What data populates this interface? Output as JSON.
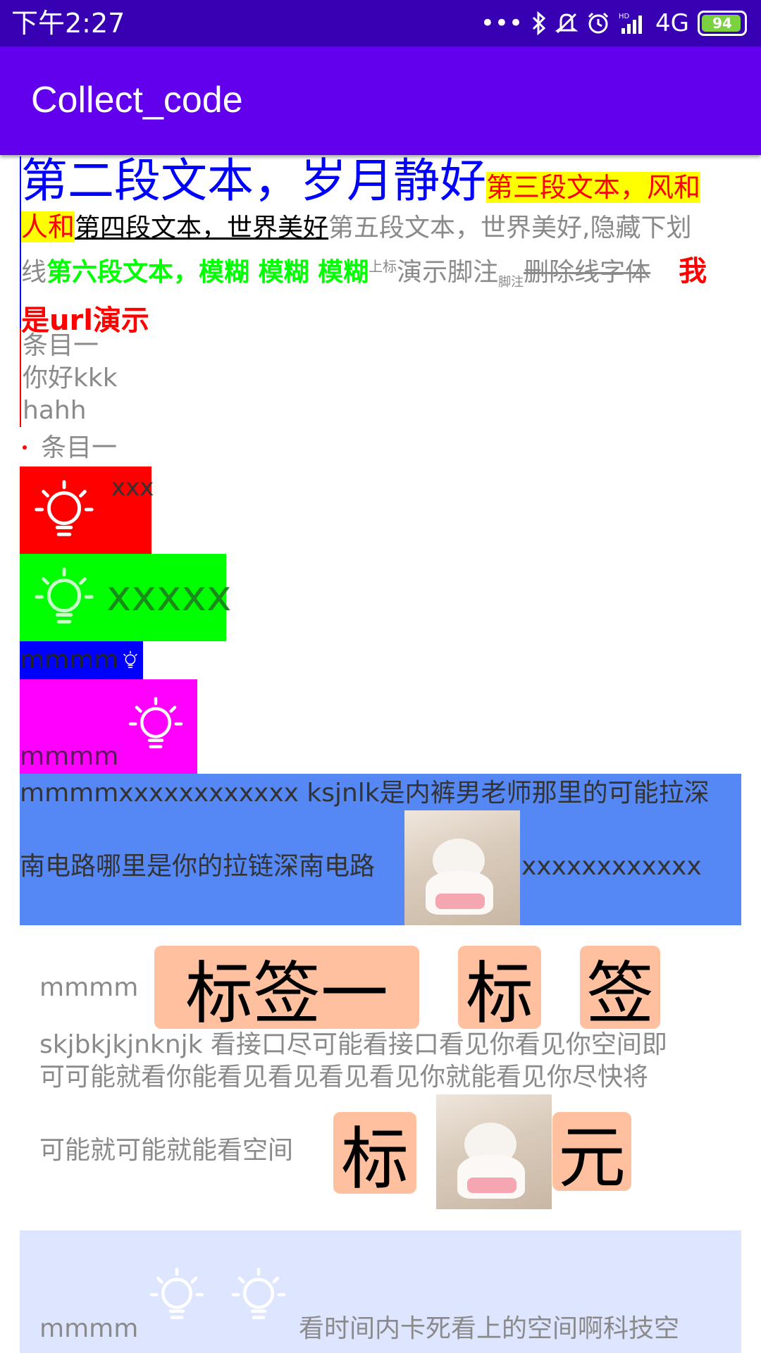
{
  "status_bar": {
    "time": "下午2:27",
    "network": "4G",
    "battery": "94",
    "icons": [
      "dots-icon",
      "bluetooth-icon",
      "mute-icon",
      "alarm-icon",
      "hd-signal-icon",
      "battery-icon"
    ]
  },
  "app_bar": {
    "title": "Collect_code"
  },
  "spans": {
    "p2": "第二段文本，岁月静好",
    "p3": "第三段文本，风和人和",
    "p4": "第四段文本，世界美好",
    "p5": "第五段文本，世界美好,",
    "p5b": "隐藏下划线",
    "p6": "第六段文本，模糊 模糊 模糊",
    "sup": "上标",
    "demo_footnote": "演示脚注",
    "sub": "脚注",
    "strike": "删除线字体",
    "url": "我是url演示"
  },
  "quote": {
    "items": [
      "条目一",
      "你好kkk",
      "hahh"
    ]
  },
  "bullet": {
    "item": "条目一"
  },
  "image_spans": {
    "red_label": "xxx",
    "green_label": "xxxxx",
    "blue_label": "mmmm",
    "magenta_label": "mmmm"
  },
  "mixed_block": {
    "line1": "mmmmxxxxxxxxxxxx  ksjnlk是内裤男老师那里的可能拉深",
    "line2_left": "南电路哪里是你的拉链深南电路",
    "line2_right": "xxxxxxxxxxxx"
  },
  "tags_block": {
    "prefix": "mmmm",
    "tags": [
      "标签一",
      "标",
      "签"
    ],
    "text1": "skjbkjkjnknjk 看接口尽可能看接口看见你看见你空间即",
    "text2": "可可能就看你能看见看见看见看见你就能看见你尽快将",
    "text3": "可能就可能就能看空间",
    "tag4": "标",
    "tag5": "元"
  },
  "bottom_block": {
    "prefix": "mmmm",
    "text": "看时间内卡死看上的空间啊科技空"
  },
  "colors": {
    "status_bar": "#3700b3",
    "app_bar": "#6200ee",
    "blue_span": "#0000ff",
    "yellow_bg": "#ffff00",
    "green_span": "#00ff00",
    "red_bg": "#ff0000",
    "green_bg": "#00ff00",
    "blue_bg": "#0000ff",
    "magenta_bg": "#ff00ff",
    "mixed_bg": "#5588f5",
    "tag_bg": "#ffc0a0",
    "bottom_bg": "#dde6fe"
  }
}
